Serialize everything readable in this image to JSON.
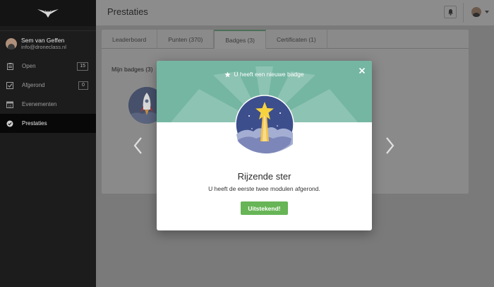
{
  "app": {
    "logo_icon": "eagle-logo-icon"
  },
  "user": {
    "name": "Sem van Geffen",
    "email": "info@droneclass.nl"
  },
  "sidebar": {
    "items": [
      {
        "label": "Open",
        "count": "15",
        "icon": "clipboard-icon",
        "active": false
      },
      {
        "label": "Afgerond",
        "count": "0",
        "icon": "checkbox-icon",
        "active": false
      },
      {
        "label": "Evenementen",
        "icon": "calendar-icon",
        "active": false
      },
      {
        "label": "Prestaties",
        "icon": "badge-check-icon",
        "active": true
      }
    ]
  },
  "header": {
    "title": "Prestaties",
    "notification_icon": "bell-icon"
  },
  "tabs": [
    {
      "label": "Leaderboard",
      "active": false
    },
    {
      "label": "Punten (370)",
      "active": false
    },
    {
      "label": "Badges (3)",
      "active": true
    },
    {
      "label": "Certificaten (1)",
      "active": false
    }
  ],
  "badges_section": {
    "label": "Mijn badges (3)"
  },
  "modal": {
    "notice": "U heeft een nieuwe badge",
    "badge_title": "Rijzende ster",
    "badge_description": "U heeft de eerste twee modulen afgerond.",
    "button_label": "Uitstekend!"
  },
  "colors": {
    "modal_header": "#74b6a2",
    "button": "#67b556",
    "sidebar": "#1c1c1c",
    "overlay": "#7a7a7a"
  }
}
